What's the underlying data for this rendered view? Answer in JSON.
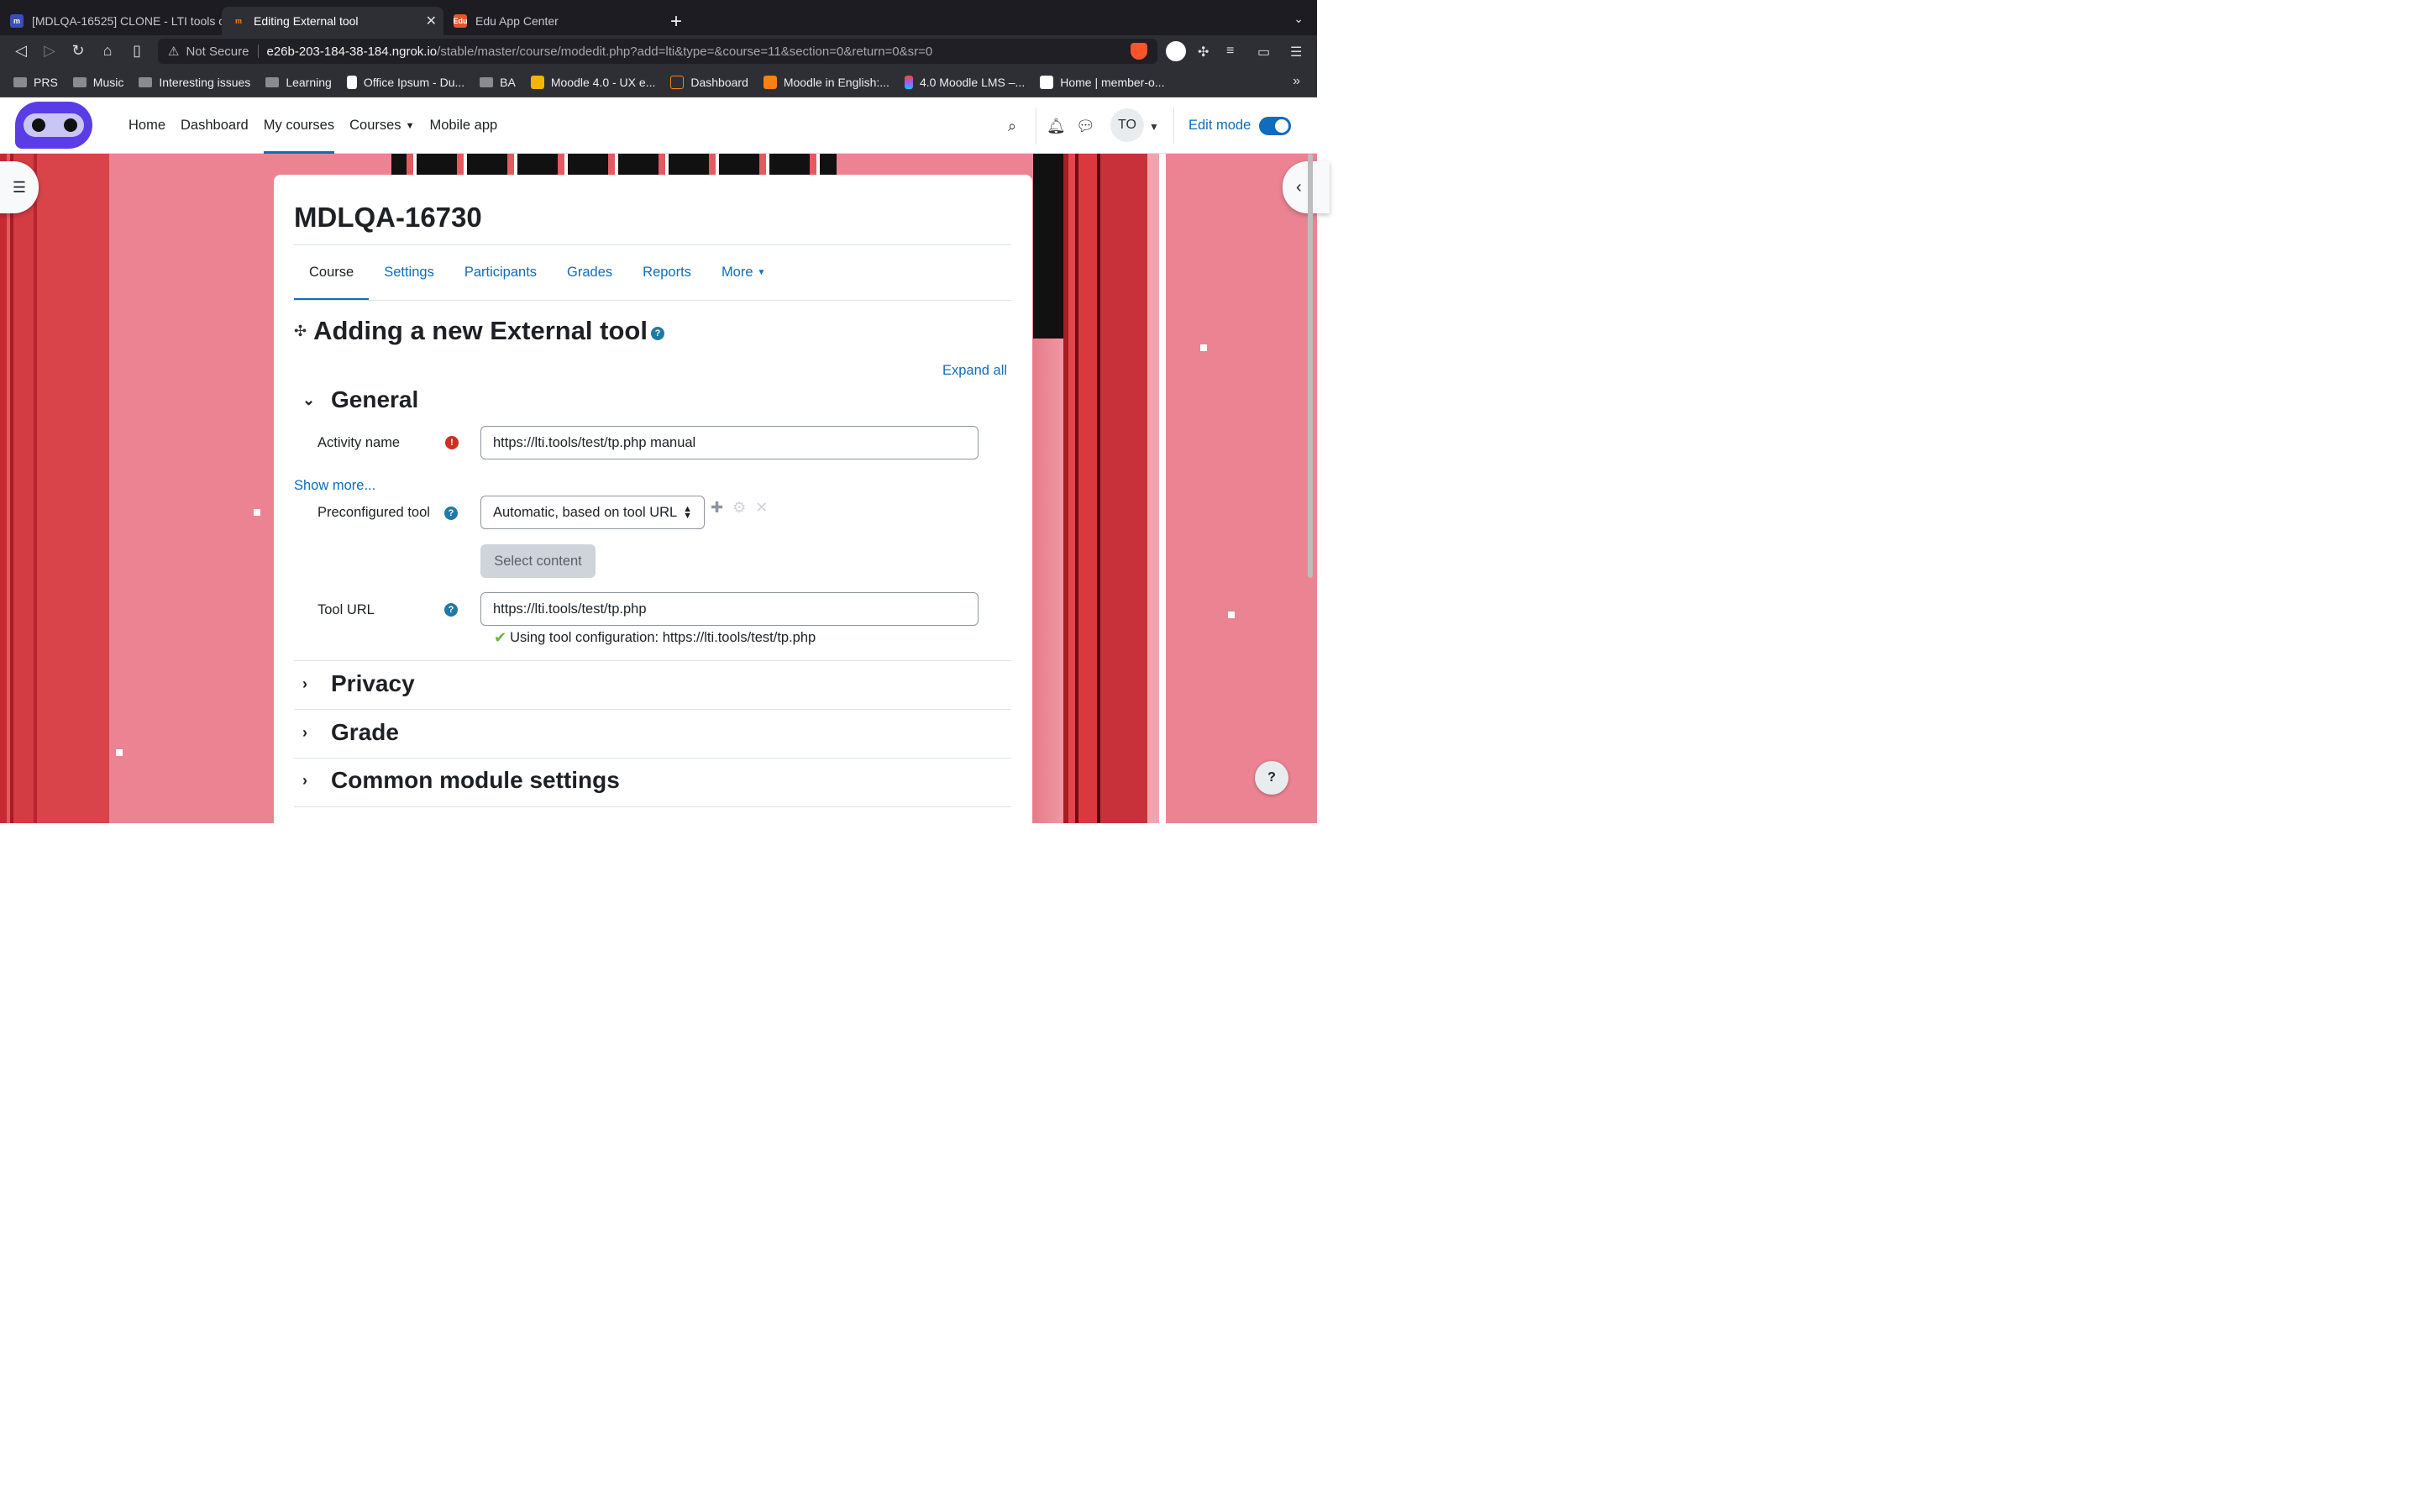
{
  "browser": {
    "tabs": [
      {
        "title": "[MDLQA-16525] CLONE - LTI tools c",
        "active": false
      },
      {
        "title": "Editing External tool",
        "active": true
      },
      {
        "title": "Edu App Center",
        "active": false
      }
    ],
    "address": {
      "security": "Not Secure",
      "host": "e26b-203-184-38-184.ngrok.io",
      "path": "/stable/master/course/modedit.php?add=lti&type=&course=11&section=0&return=0&sr=0"
    },
    "bookmarks": [
      "PRS",
      "Music",
      "Interesting issues",
      "Learning",
      "Office Ipsum - Du...",
      "BA",
      "Moodle 4.0 - UX e...",
      "Dashboard",
      "Moodle in English:...",
      "4.0 Moodle LMS –...",
      "Home | member-o..."
    ],
    "more_bookmarks": "»"
  },
  "moodle_header": {
    "nav": [
      "Home",
      "Dashboard",
      "My courses",
      "Courses",
      "Mobile app"
    ],
    "active_nav": "My courses",
    "user_initials": "TO",
    "edit_mode_label": "Edit mode",
    "edit_mode_on": true
  },
  "course": {
    "title": "MDLQA-16730",
    "tabs": [
      "Course",
      "Settings",
      "Participants",
      "Grades",
      "Reports",
      "More"
    ],
    "active_tab": "Course"
  },
  "page": {
    "heading": "Adding a new External tool",
    "expand_all": "Expand all",
    "sections": {
      "general": "General",
      "privacy": "Privacy",
      "grade": "Grade",
      "common": "Common module settings"
    },
    "fields": {
      "activity_name_label": "Activity name",
      "activity_name_value": "https://lti.tools/test/tp.php manual",
      "show_more": "Show more...",
      "preconfigured_label": "Preconfigured tool",
      "preconfigured_value": "Automatic, based on tool URL",
      "select_content": "Select content",
      "tool_url_label": "Tool URL",
      "tool_url_value": "https://lti.tools/test/tp.php",
      "using_config": "Using tool configuration: https://lti.tools/test/tp.php"
    }
  },
  "colors": {
    "brand_blue": "#0f6cbf",
    "required_red": "#ca3120",
    "help_blue": "#1f7aa6",
    "background_pink": "#ec8393",
    "stripe_red": "#d13b3f"
  }
}
